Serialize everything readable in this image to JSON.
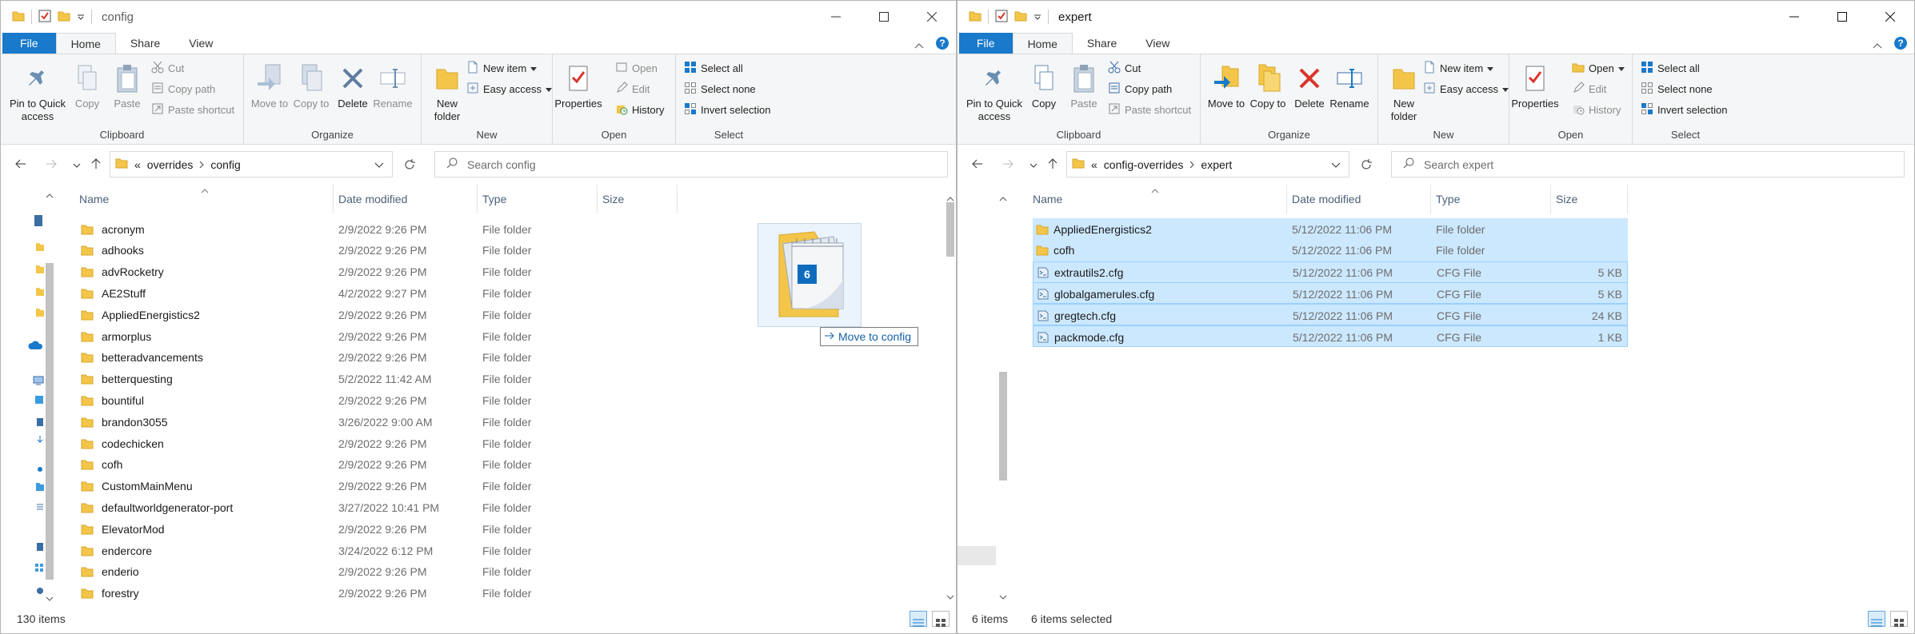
{
  "left": {
    "title": "config",
    "tabs": [
      "File",
      "Home",
      "Share",
      "View"
    ],
    "ribbon": {
      "clipboard": {
        "label": "Clipboard",
        "pin": "Pin to Quick access",
        "copy": "Copy",
        "paste": "Paste",
        "cut": "Cut",
        "copy_path": "Copy path",
        "paste_shortcut": "Paste shortcut"
      },
      "organize": {
        "label": "Organize",
        "move_to": "Move to",
        "copy_to": "Copy to",
        "delete": "Delete",
        "rename": "Rename"
      },
      "new": {
        "label": "New",
        "new_folder": "New folder",
        "new_item": "New item",
        "easy_access": "Easy access"
      },
      "open": {
        "label": "Open",
        "properties": "Properties",
        "open": "Open",
        "edit": "Edit",
        "history": "History"
      },
      "select": {
        "label": "Select",
        "select_all": "Select all",
        "select_none": "Select none",
        "invert": "Invert selection"
      }
    },
    "address": {
      "overflow": "«",
      "crumbs": [
        "overrides",
        "config"
      ]
    },
    "search_placeholder": "Search config",
    "columns": {
      "name": "Name",
      "date": "Date modified",
      "type": "Type",
      "size": "Size"
    },
    "rows": [
      {
        "name": "acronym",
        "date": "2/9/2022 9:26 PM",
        "type": "File folder"
      },
      {
        "name": "adhooks",
        "date": "2/9/2022 9:26 PM",
        "type": "File folder"
      },
      {
        "name": "advRocketry",
        "date": "2/9/2022 9:26 PM",
        "type": "File folder"
      },
      {
        "name": "AE2Stuff",
        "date": "4/2/2022 9:27 PM",
        "type": "File folder"
      },
      {
        "name": "AppliedEnergistics2",
        "date": "2/9/2022 9:26 PM",
        "type": "File folder"
      },
      {
        "name": "armorplus",
        "date": "2/9/2022 9:26 PM",
        "type": "File folder"
      },
      {
        "name": "betteradvancements",
        "date": "2/9/2022 9:26 PM",
        "type": "File folder"
      },
      {
        "name": "betterquesting",
        "date": "5/2/2022 11:42 AM",
        "type": "File folder"
      },
      {
        "name": "bountiful",
        "date": "2/9/2022 9:26 PM",
        "type": "File folder"
      },
      {
        "name": "brandon3055",
        "date": "3/26/2022 9:00 AM",
        "type": "File folder"
      },
      {
        "name": "codechicken",
        "date": "2/9/2022 9:26 PM",
        "type": "File folder"
      },
      {
        "name": "cofh",
        "date": "2/9/2022 9:26 PM",
        "type": "File folder"
      },
      {
        "name": "CustomMainMenu",
        "date": "2/9/2022 9:26 PM",
        "type": "File folder"
      },
      {
        "name": "defaultworldgenerator-port",
        "date": "3/27/2022 10:41 PM",
        "type": "File folder"
      },
      {
        "name": "ElevatorMod",
        "date": "2/9/2022 9:26 PM",
        "type": "File folder"
      },
      {
        "name": "endercore",
        "date": "3/24/2022 6:12 PM",
        "type": "File folder"
      },
      {
        "name": "enderio",
        "date": "2/9/2022 9:26 PM",
        "type": "File folder"
      },
      {
        "name": "forestry",
        "date": "2/9/2022 9:26 PM",
        "type": "File folder"
      }
    ],
    "status": "130 items",
    "drag": {
      "count": "6",
      "tip": "Move to config"
    }
  },
  "right": {
    "title": "expert",
    "tabs": [
      "File",
      "Home",
      "Share",
      "View"
    ],
    "ribbon": {
      "clipboard": {
        "label": "Clipboard",
        "pin": "Pin to Quick access",
        "copy": "Copy",
        "paste": "Paste",
        "cut": "Cut",
        "copy_path": "Copy path",
        "paste_shortcut": "Paste shortcut"
      },
      "organize": {
        "label": "Organize",
        "move_to": "Move to",
        "copy_to": "Copy to",
        "delete": "Delete",
        "rename": "Rename"
      },
      "new": {
        "label": "New",
        "new_folder": "New folder",
        "new_item": "New item",
        "easy_access": "Easy access"
      },
      "open": {
        "label": "Open",
        "properties": "Properties",
        "open": "Open",
        "edit": "Edit",
        "history": "History"
      },
      "select": {
        "label": "Select",
        "select_all": "Select all",
        "select_none": "Select none",
        "invert": "Invert selection"
      }
    },
    "address": {
      "overflow": "«",
      "crumbs": [
        "config-overrides",
        "expert"
      ]
    },
    "search_placeholder": "Search expert",
    "columns": {
      "name": "Name",
      "date": "Date modified",
      "type": "Type",
      "size": "Size"
    },
    "rows": [
      {
        "name": "AppliedEnergistics2",
        "date": "5/12/2022 11:06 PM",
        "type": "File folder",
        "size": ""
      },
      {
        "name": "cofh",
        "date": "5/12/2022 11:06 PM",
        "type": "File folder",
        "size": ""
      },
      {
        "name": "extrautils2.cfg",
        "date": "5/12/2022 11:06 PM",
        "type": "CFG File",
        "size": "5 KB"
      },
      {
        "name": "globalgamerules.cfg",
        "date": "5/12/2022 11:06 PM",
        "type": "CFG File",
        "size": "5 KB"
      },
      {
        "name": "gregtech.cfg",
        "date": "5/12/2022 11:06 PM",
        "type": "CFG File",
        "size": "24 KB"
      },
      {
        "name": "packmode.cfg",
        "date": "5/12/2022 11:06 PM",
        "type": "CFG File",
        "size": "1 KB"
      }
    ],
    "status": "6 items",
    "status_selected": "6 items selected"
  },
  "colors": {
    "file_tab": "#1979ca",
    "selection": "#cce8ff",
    "selection_border": "#99d1ff",
    "folder": "#f3c64a",
    "header_text": "#4c607a"
  }
}
